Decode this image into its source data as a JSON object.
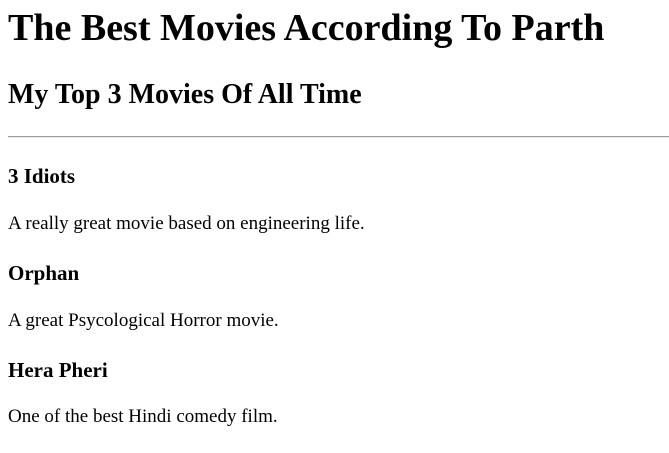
{
  "page": {
    "title": "The Best Movies According To Parth",
    "subtitle": "My Top 3 Movies Of All Time"
  },
  "movies": [
    {
      "title": "3 Idiots",
      "description": "A really great movie based on engineering life."
    },
    {
      "title": "Orphan",
      "description": "A great Psycological Horror movie."
    },
    {
      "title": "Hera Pheri",
      "description": "One of the best Hindi comedy film."
    }
  ]
}
